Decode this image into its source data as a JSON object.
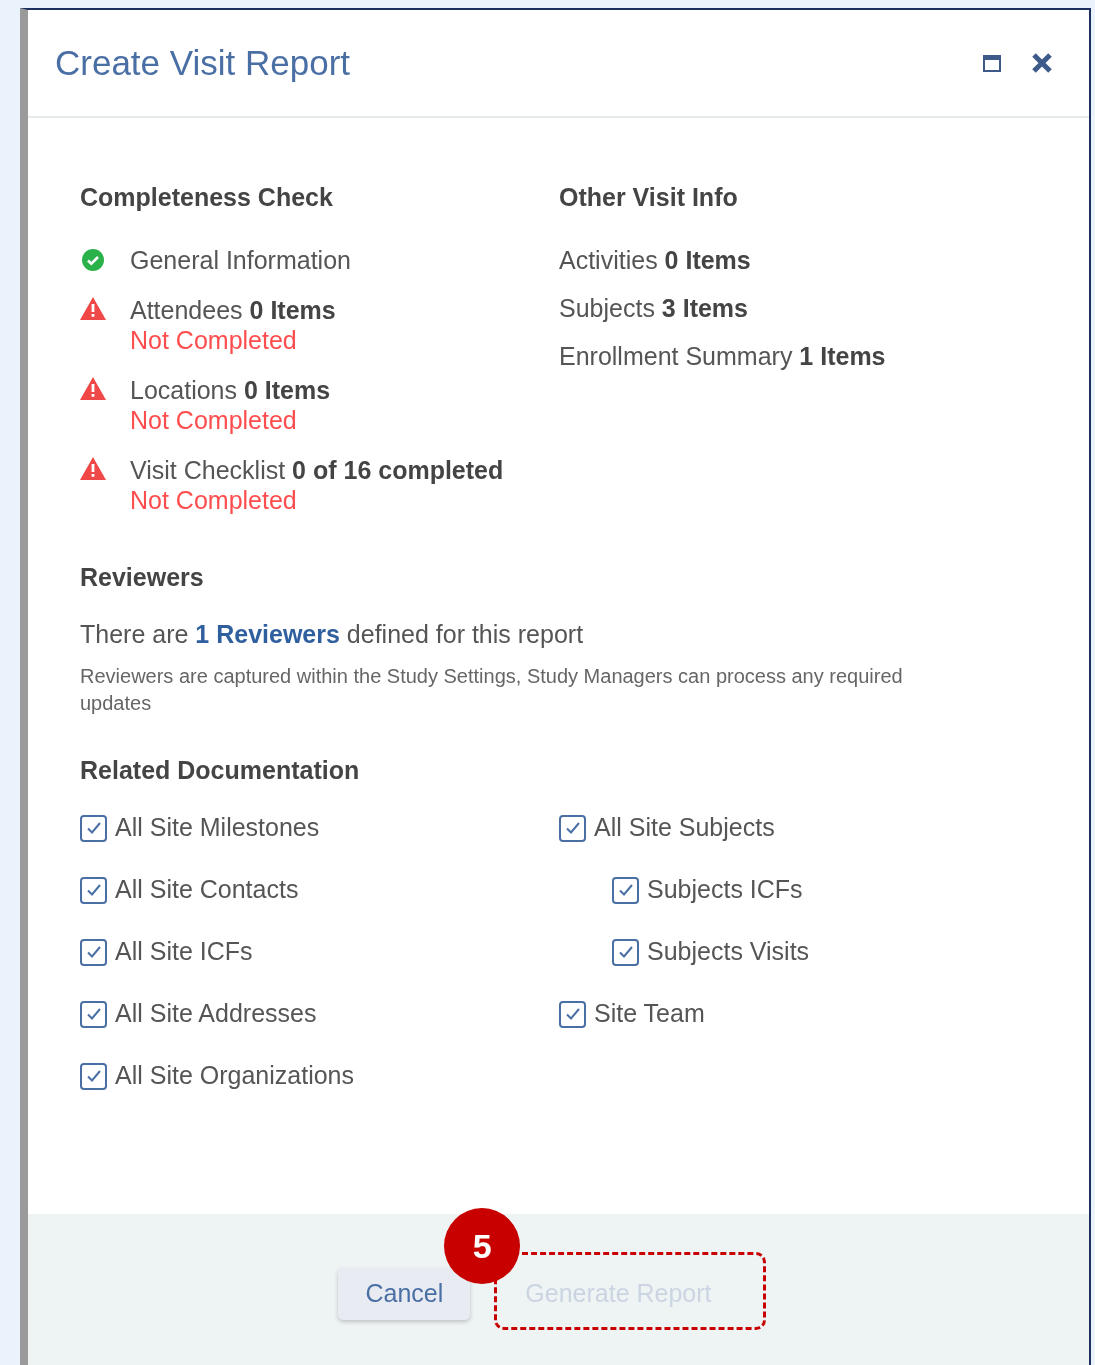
{
  "dialog": {
    "title": "Create Visit Report"
  },
  "completeness": {
    "heading": "Completeness Check",
    "items": [
      {
        "label": "General Information",
        "complete": true
      },
      {
        "label": "Attendees",
        "value": "0 Items",
        "complete": false,
        "note": "Not Completed"
      },
      {
        "label": "Locations",
        "value": "0 Items",
        "complete": false,
        "note": "Not Completed"
      },
      {
        "label": "Visit Checklist",
        "value": "0 of 16 completed",
        "complete": false,
        "note": "Not Completed"
      }
    ]
  },
  "other_info": {
    "heading": "Other Visit Info",
    "items": [
      {
        "label": "Activities",
        "value": "0 Items"
      },
      {
        "label": "Subjects",
        "value": "3 Items"
      },
      {
        "label": "Enrollment Summary",
        "value": "1 Items"
      }
    ]
  },
  "reviewers": {
    "heading": "Reviewers",
    "prefix": "There are",
    "link": "1 Reviewers",
    "suffix": "defined for this report",
    "note": "Reviewers are captured within the Study Settings, Study Managers can process any required updates"
  },
  "related_documentation": {
    "heading": "Related Documentation",
    "columns": [
      [
        {
          "label": "All Site Milestones",
          "checked": true
        },
        {
          "label": "All Site Contacts",
          "checked": true
        },
        {
          "label": "All Site ICFs",
          "checked": true
        },
        {
          "label": "All Site Addresses",
          "checked": true
        },
        {
          "label": "All Site Organizations",
          "checked": true
        }
      ],
      [
        {
          "label": "All Site Subjects",
          "checked": true,
          "children": [
            {
              "label": "Subjects ICFs",
              "checked": true
            },
            {
              "label": "Subjects Visits",
              "checked": true
            }
          ]
        },
        {
          "label": "Site Team",
          "checked": true
        }
      ]
    ]
  },
  "buttons": [
    {
      "label": "Cancel",
      "disabled": false
    },
    {
      "label": "Generate Report",
      "disabled": true,
      "highlighted": true
    }
  ],
  "annotation": {
    "number": "5"
  }
}
